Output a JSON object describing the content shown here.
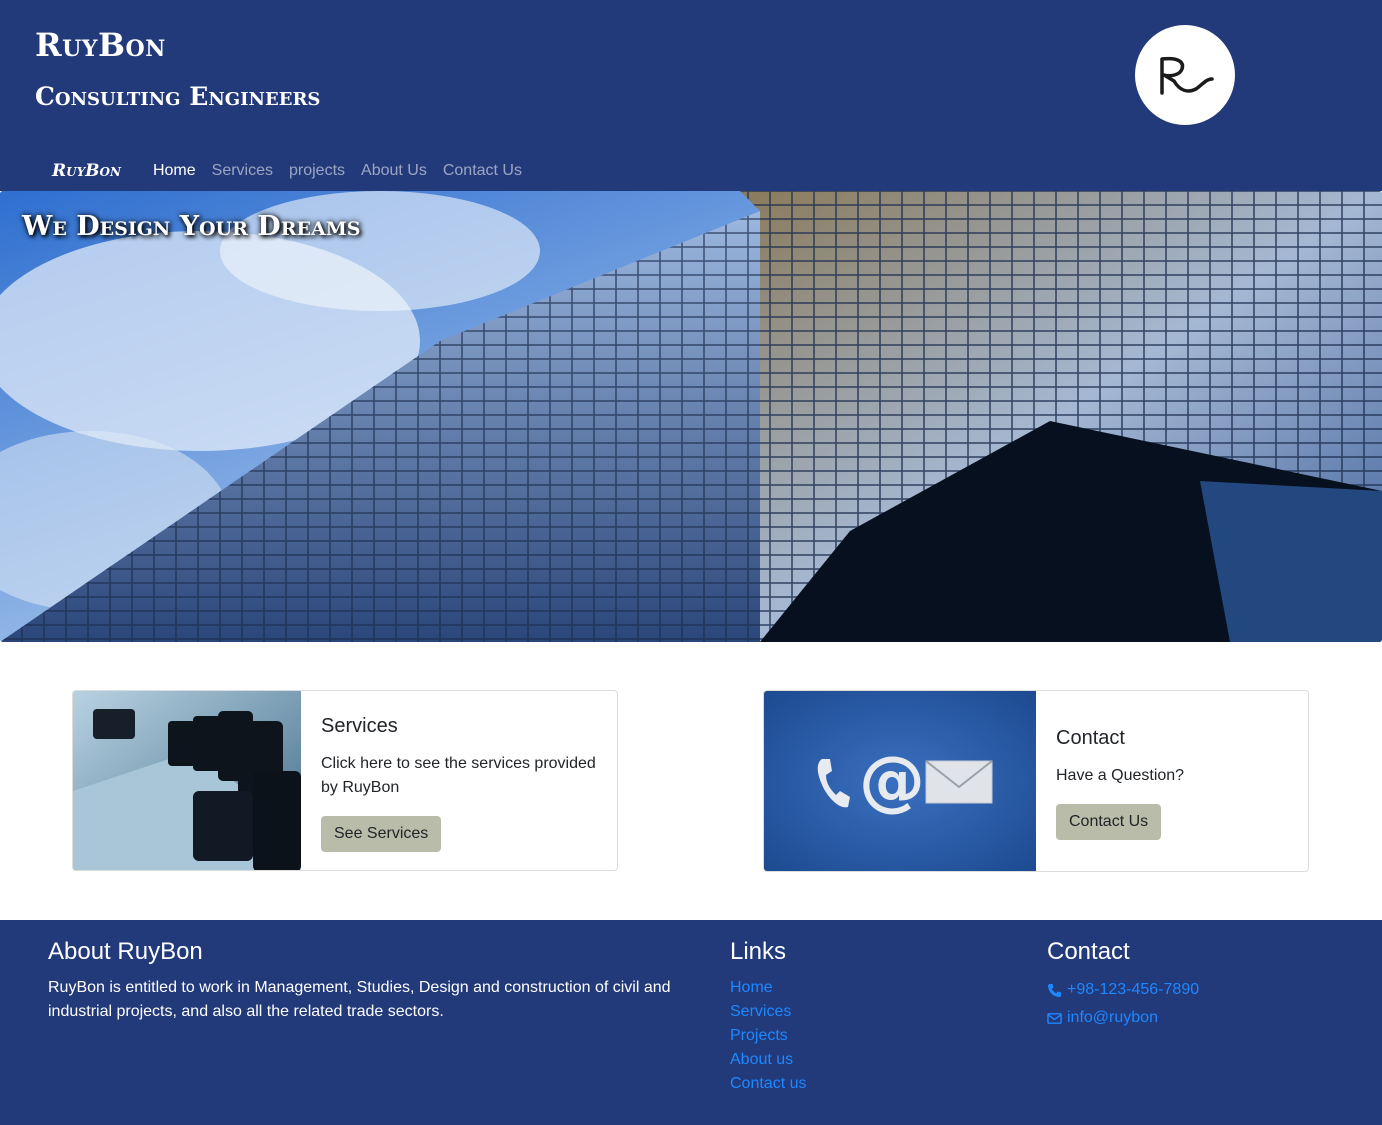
{
  "header": {
    "title": "RuyBon",
    "subtitle": "Consulting Engineers",
    "logo_icon": "rl-logo-icon"
  },
  "nav": {
    "brand": "RuyBon",
    "links": [
      "Home",
      "Services",
      "projects",
      "About Us",
      "Contact Us"
    ],
    "active": "Home"
  },
  "hero": {
    "title": "We Design Your Dreams"
  },
  "cards": {
    "services": {
      "title": "Services",
      "text": "Click here to see the services provided by RuyBon",
      "button": "See Services"
    },
    "contact": {
      "title": "Contact",
      "text": "Have a Question?",
      "button": "Contact Us"
    }
  },
  "footer": {
    "about": {
      "heading": "About RuyBon",
      "text": "RuyBon is entitled to work in Management, Studies, Design and construction of civil and industrial projects, and also all the related trade sectors."
    },
    "links": {
      "heading": "Links",
      "items": [
        "Home",
        "Services",
        "Projects",
        "About us",
        "Contact us"
      ]
    },
    "contact": {
      "heading": "Contact",
      "phone": "+98-123-456-7890",
      "email": "info@ruybon"
    }
  },
  "colors": {
    "brand_navy": "#22397a",
    "button_khaki": "#b8bca8",
    "link_blue": "#1e88ff"
  }
}
